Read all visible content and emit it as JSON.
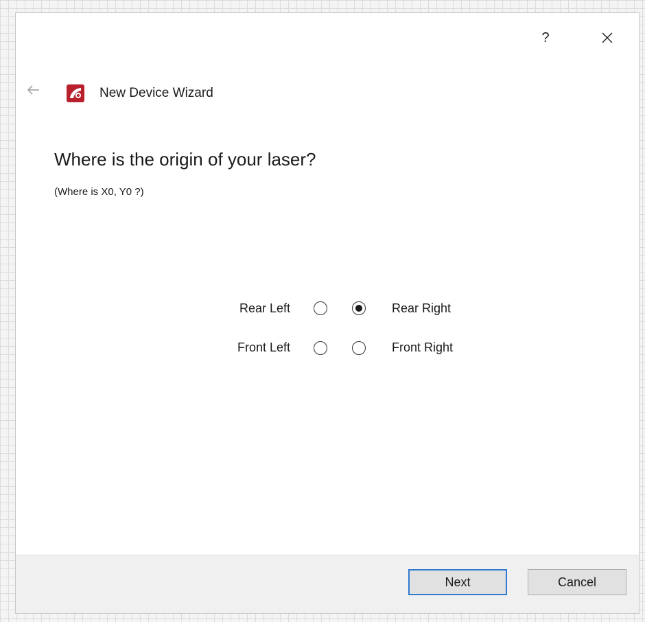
{
  "titlebar": {
    "help_label": "?"
  },
  "wizard": {
    "title": "New Device Wizard",
    "question": "Where is the origin of your laser?",
    "subtext": "(Where is X0, Y0 ?)"
  },
  "origin_options": {
    "rear_left": "Rear Left",
    "rear_right": "Rear Right",
    "front_left": "Front Left",
    "front_right": "Front Right",
    "selected": "Rear Right"
  },
  "footer": {
    "next_label": "Next",
    "cancel_label": "Cancel"
  },
  "colors": {
    "logo_red": "#b8202c",
    "focus_blue": "#2e7bd0"
  }
}
